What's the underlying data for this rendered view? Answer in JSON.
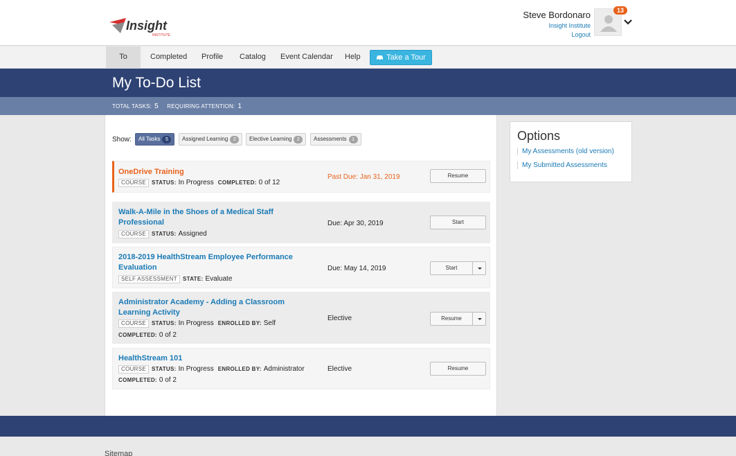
{
  "brand": {
    "name": "Insight",
    "sub": "INSTITUTE"
  },
  "user": {
    "name": "Steve Bordonaro",
    "org": "Insight Institute",
    "logout": "Logout",
    "notification_count": "13"
  },
  "nav": {
    "items": [
      "To Do",
      "Completed",
      "Profile",
      "Catalog",
      "Event Calendar",
      "Help"
    ],
    "tour": "Take a Tour"
  },
  "page": {
    "title": "My To-Do List",
    "total_tasks_label": "TOTAL TASKS:",
    "total_tasks": "5",
    "attention_label": "REQUIRING ATTENTION:",
    "attention": "1"
  },
  "filters": {
    "show_label": "Show:",
    "items": [
      {
        "label": "All Tasks",
        "count": "5"
      },
      {
        "label": "Assigned Learning",
        "count": "2"
      },
      {
        "label": "Elective Learning",
        "count": "2"
      },
      {
        "label": "Assessments",
        "count": "1"
      }
    ]
  },
  "tasks": [
    {
      "title": "OneDrive Training",
      "type": "COURSE",
      "l1": "STATUS:",
      "v1": "In Progress",
      "l2": "COMPLETED:",
      "v2": "0 of 12",
      "l3": "",
      "v3": "",
      "due": "Past Due: Jan 31, 2019",
      "action": "Resume"
    },
    {
      "title": "Walk-A-Mile in the Shoes of a Medical Staff Professional",
      "type": "COURSE",
      "l1": "STATUS:",
      "v1": "Assigned",
      "l2": "",
      "v2": "",
      "l3": "",
      "v3": "",
      "due": "Due: Apr 30, 2019",
      "action": "Start"
    },
    {
      "title": "2018-2019 HealthStream Employee Performance Evaluation",
      "type": "SELF ASSESSMENT",
      "l1": "STATE:",
      "v1": "Evaluate",
      "l2": "",
      "v2": "",
      "l3": "",
      "v3": "",
      "due": "Due: May 14, 2019",
      "action": "Start"
    },
    {
      "title": "Administrator Academy - Adding a Classroom Learning Activity",
      "type": "COURSE",
      "l1": "STATUS:",
      "v1": "In Progress",
      "l2": "ENROLLED BY:",
      "v2": "Self",
      "l3": "COMPLETED:",
      "v3": "0 of 2",
      "due": "Elective",
      "action": "Resume"
    },
    {
      "title": "HealthStream 101",
      "type": "COURSE",
      "l1": "STATUS:",
      "v1": "In Progress",
      "l2": "ENROLLED BY:",
      "v2": "Administrator",
      "l3": "COMPLETED:",
      "v3": "0 of 2",
      "due": "Elective",
      "action": "Resume"
    }
  ],
  "options": {
    "title": "Options",
    "links": [
      "My Assessments (old version)",
      "My Submitted Assessments"
    ]
  },
  "footer": {
    "sitemap": "Sitemap"
  },
  "colors": {
    "navy": "#2e4374",
    "accent": "#3ab5e0",
    "overdue": "#e8621a",
    "link": "#1a7ab5"
  }
}
